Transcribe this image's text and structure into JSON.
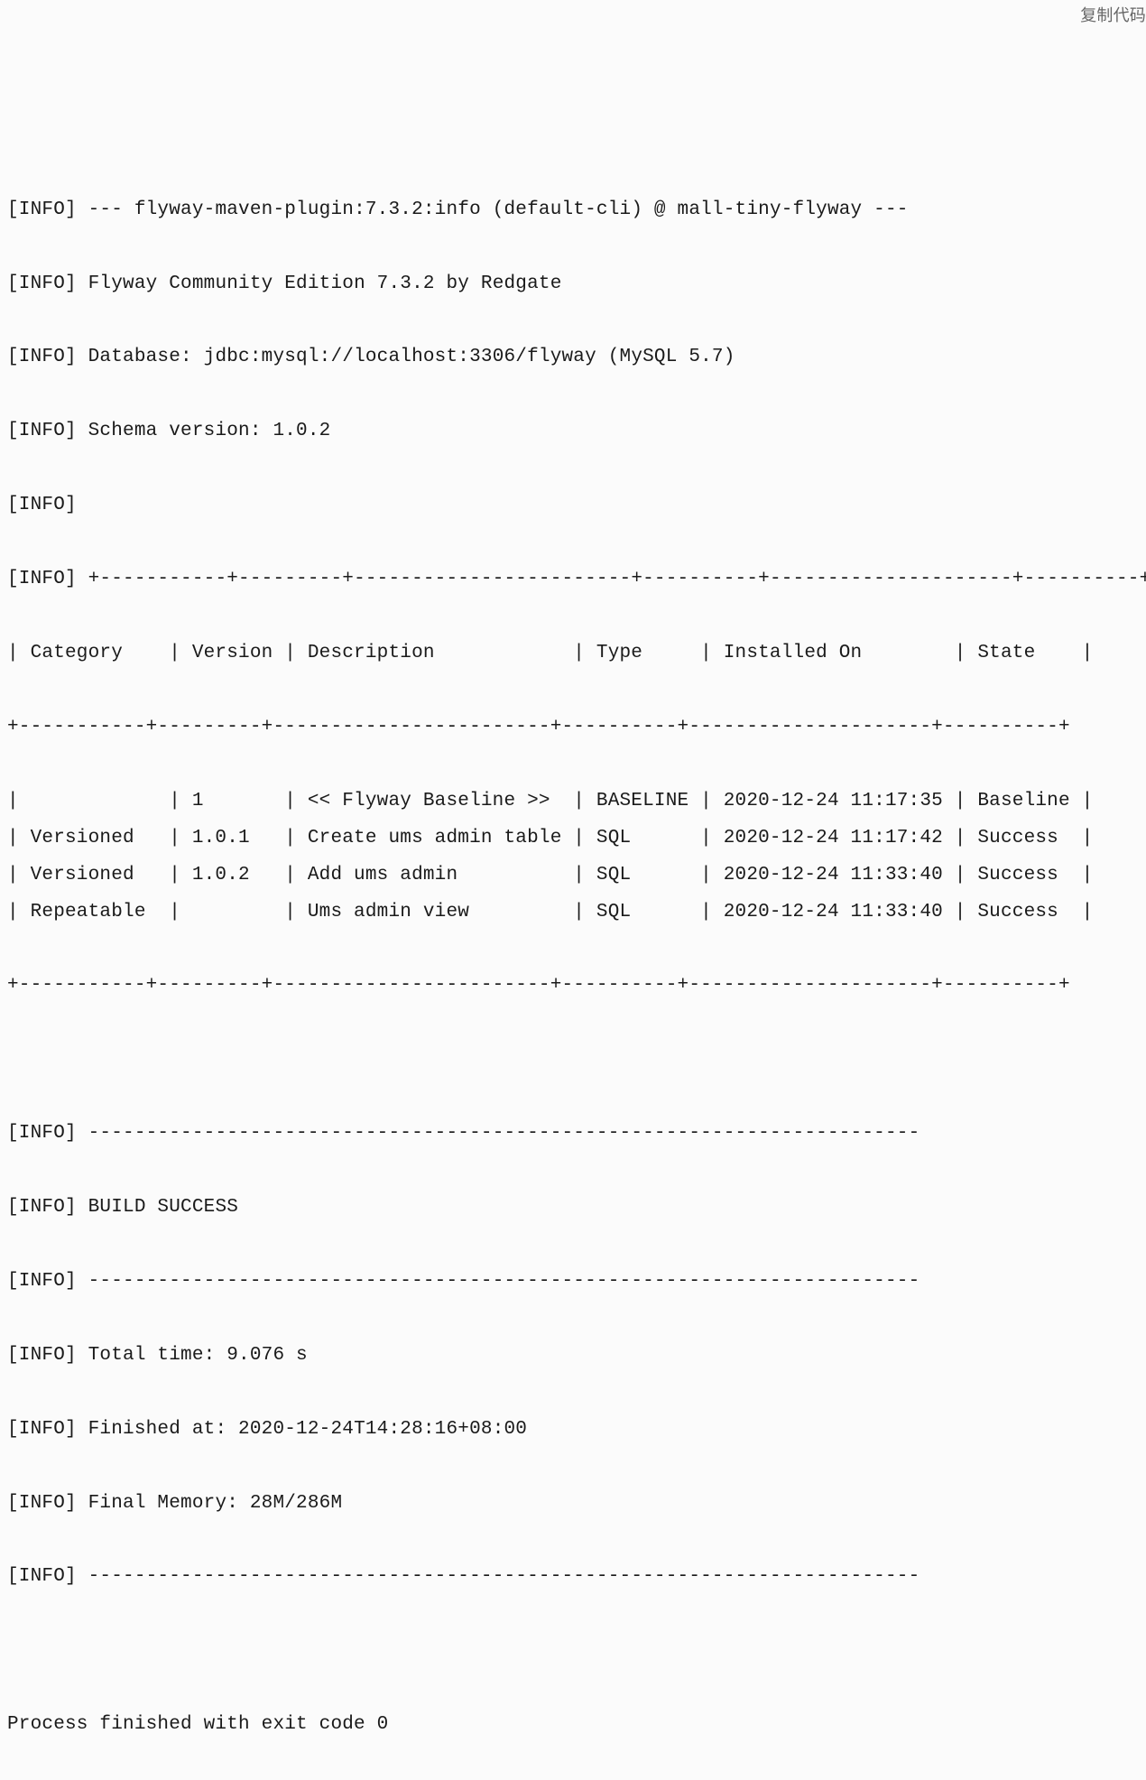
{
  "corner_label": "复制代码",
  "info_prefix": "[INFO]",
  "lines": {
    "plugin_line": "--- flyway-maven-plugin:7.3.2:info (default-cli) @ mall-tiny-flyway ---",
    "edition_line": "Flyway Community Edition 7.3.2 by Redgate",
    "database_line": "Database: jdbc:mysql://localhost:3306/flyway (MySQL 5.7)",
    "schema_version_line": "Schema version: 1.0.2",
    "empty_info": "",
    "table_border": "+-----------+---------+------------------------+----------+---------------------+----------+------",
    "row_border": "+-----------+---------+------------------------+----------+---------------------+----------+",
    "build_dashes": "------------------------------------------------------------------------",
    "build_success": "BUILD SUCCESS",
    "total_time": "Total time: 9.076 s",
    "finished_at": "Finished at: 2020-12-24T14:28:16+08:00",
    "final_memory": "Final Memory: 28M/286M"
  },
  "table": {
    "headers": {
      "category": "Category",
      "version": "Version",
      "description": "Description",
      "type": "Type",
      "installed_on": "Installed On",
      "state": "State"
    },
    "rows": [
      {
        "category": "",
        "version": "1",
        "description": "<< Flyway Baseline >>",
        "type": "BASELINE",
        "installed_on": "2020-12-24 11:17:35",
        "state": "Baseline"
      },
      {
        "category": "Versioned",
        "version": "1.0.1",
        "description": "Create ums admin table",
        "type": "SQL",
        "installed_on": "2020-12-24 11:17:42",
        "state": "Success"
      },
      {
        "category": "Versioned",
        "version": "1.0.2",
        "description": "Add ums admin",
        "type": "SQL",
        "installed_on": "2020-12-24 11:33:40",
        "state": "Success"
      },
      {
        "category": "Repeatable",
        "version": "",
        "description": "Ums admin view",
        "type": "SQL",
        "installed_on": "2020-12-24 11:33:40",
        "state": "Success"
      }
    ]
  },
  "process_line": "Process finished with exit code 0"
}
